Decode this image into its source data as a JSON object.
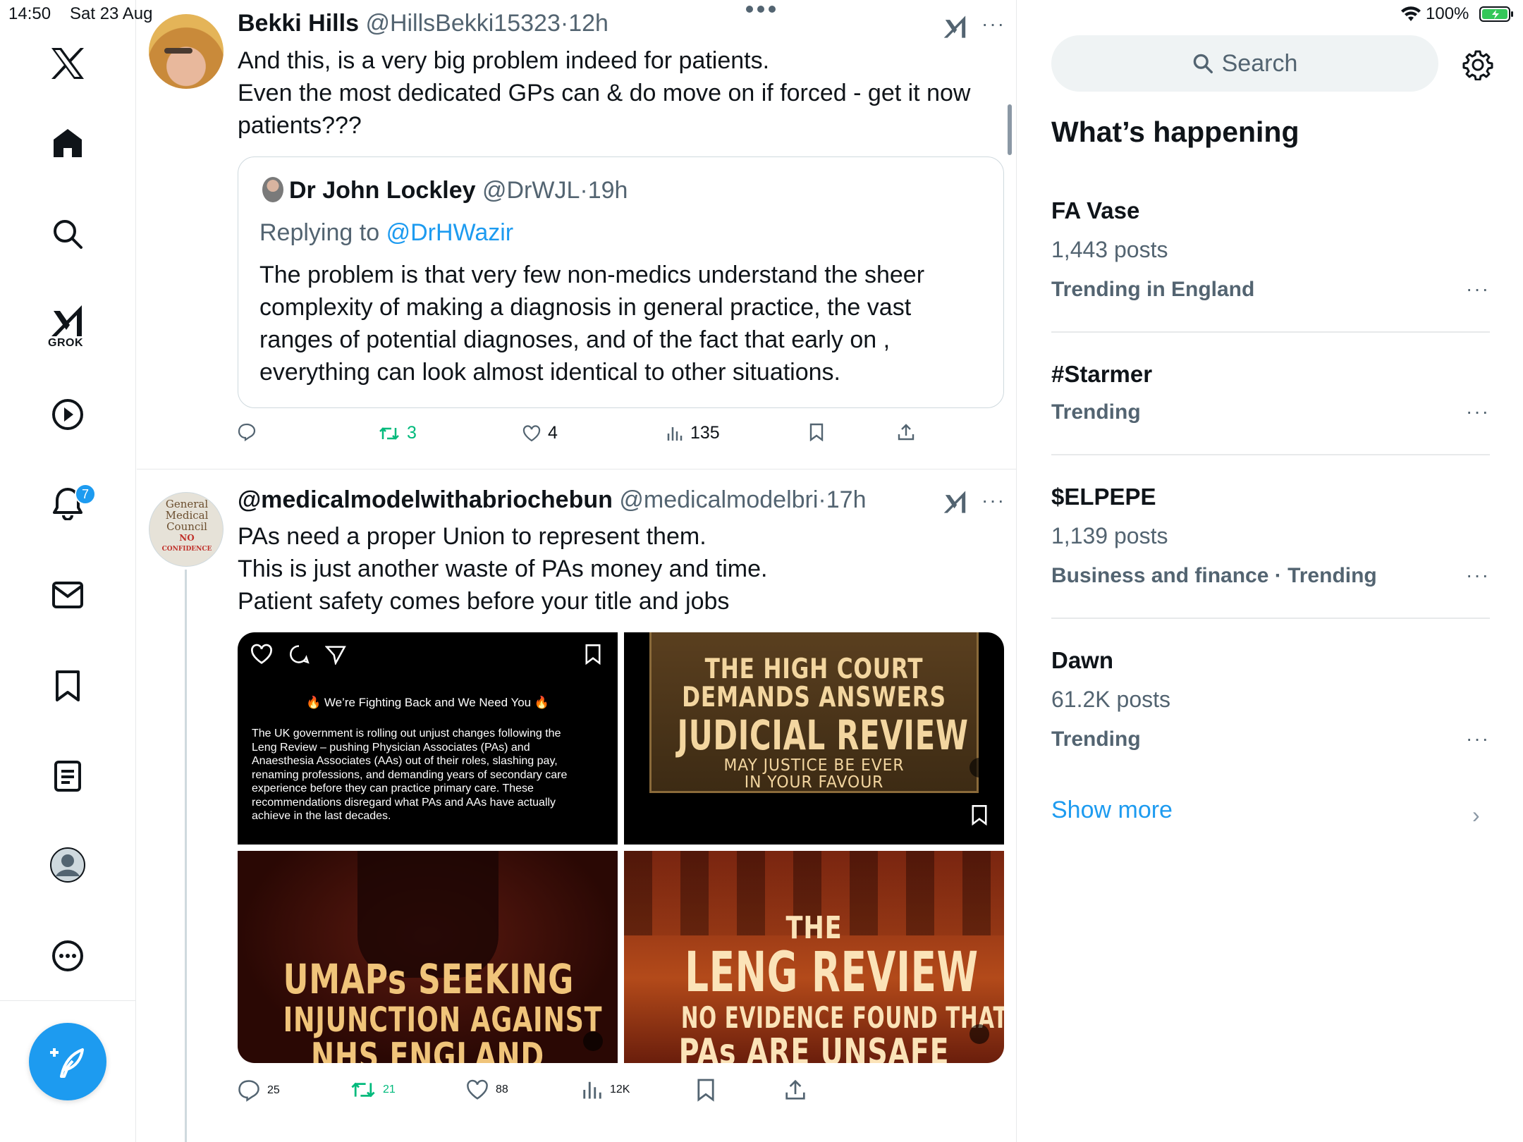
{
  "status_bar": {
    "time": "14:50",
    "date": "Sat 23 Aug",
    "battery": "100%"
  },
  "nav": {
    "logo": "x-logo-icon",
    "items": [
      "home-icon",
      "explore-icon",
      "grok-icon",
      "video-icon",
      "notifications-icon",
      "messages-icon",
      "bookmarks-icon",
      "lists-icon",
      "profile-icon",
      "more-icon"
    ],
    "grok_label": "GROK",
    "notifications_count": "7",
    "compose_icon": "compose-icon"
  },
  "tweet1": {
    "name": "Bekki Hills",
    "handle": "@HillsBekki15323",
    "sep": "·",
    "time": "12h",
    "lines": [
      "And this, is a very big problem indeed for patients.",
      "Even the most dedicated GPs can & do move on if forced - get it now",
      "patients???"
    ],
    "quote": {
      "name": "Dr John Lockley",
      "handle": "@DrWJL",
      "time": "19h",
      "reply_prefix": "Replying to",
      "reply_to": "@DrHWazir",
      "lines": [
        "The problem is that very few non-medics understand the sheer",
        "complexity of making a diagnosis in general practice, the vast",
        "ranges of potential diagnoses, and of the fact that early on ,",
        "everything can look almost identical to other situations."
      ]
    },
    "actions": {
      "replies": "",
      "reposts": "3",
      "likes": "4",
      "views": "135"
    }
  },
  "tweet2": {
    "name": "@medicalmodelwithabriochebun",
    "handle": "@medicalmodelbri",
    "sep": "·",
    "time": "17h",
    "avatar_text": [
      "General",
      "Medical",
      "Council",
      "NO",
      "CONFIDENCE"
    ],
    "lines": [
      "PAs need a proper Union to represent them.",
      "This is just another waste of PAs money and time.",
      "Patient safety comes before your  title and jobs"
    ],
    "media": {
      "tile1": {
        "heading": "We’re Fighting Back and We Need You",
        "text": [
          "The UK government is rolling out unjust changes following the",
          "Leng Review – pushing Physician Associates (PAs) and",
          "Anaesthesia Associates (AAs) out of their roles, slashing pay,",
          "renaming professions, and demanding years of secondary care",
          "experience before they can practice primary care. These",
          "recommendations disregard what PAs and AAs have actually",
          "achieve in the last decades."
        ]
      },
      "tile2": {
        "lines": [
          "THE HIGH COURT",
          "DEMANDS ANSWERS",
          "JUDICIAL REVIEW",
          "MAY JUSTICE BE EVER",
          "IN YOUR FAVOUR"
        ]
      },
      "tile3": {
        "lines": [
          "UMAPs SEEKING",
          "INJUNCTION AGAINST",
          "NHS ENGLAND"
        ]
      },
      "tile4": {
        "lines": [
          "THE",
          "LENG REVIEW",
          "NO EVIDENCE FOUND THAT",
          "PAs ARE UNSAFE"
        ]
      }
    },
    "actions": {
      "replies": "25",
      "reposts": "21",
      "likes": "88",
      "views": "12K"
    }
  },
  "sidebar": {
    "search_placeholder": "Search",
    "heading": "What’s happening",
    "trends": [
      {
        "title": "FA Vase",
        "posts": "1,443 posts",
        "meta": "Trending in England"
      },
      {
        "title": "#Starmer",
        "posts": "",
        "meta": "Trending"
      },
      {
        "title": "$ELPEPE",
        "posts": "1,139 posts",
        "meta": "Business and finance · Trending"
      },
      {
        "title": "Dawn",
        "posts": "61.2K posts",
        "meta": "Trending"
      }
    ],
    "show_more": "Show more",
    "more_glyph": "···",
    "chevron": "›"
  },
  "colors": {
    "accent": "#1d9bf0",
    "repost": "#00ba7c",
    "muted": "#536471",
    "divider": "#e7e9ea"
  }
}
